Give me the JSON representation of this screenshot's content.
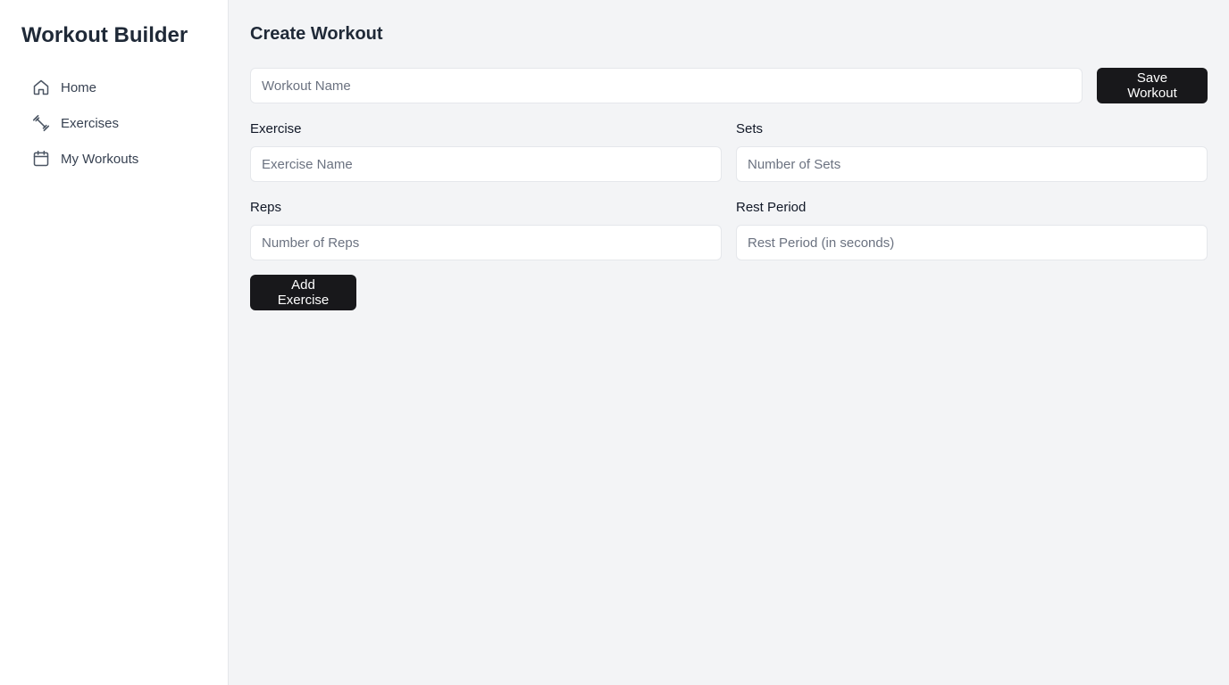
{
  "app": {
    "title": "Workout Builder"
  },
  "sidebar": {
    "items": [
      {
        "label": "Home",
        "icon": "home-icon"
      },
      {
        "label": "Exercises",
        "icon": "dumbbell-icon"
      },
      {
        "label": "My Workouts",
        "icon": "calendar-icon"
      }
    ]
  },
  "main": {
    "title": "Create Workout",
    "workout_name": {
      "placeholder": "Workout Name",
      "value": ""
    },
    "save_button": "Save Workout",
    "exercise": {
      "label": "Exercise",
      "placeholder": "Exercise Name",
      "value": ""
    },
    "sets": {
      "label": "Sets",
      "placeholder": "Number of Sets",
      "value": ""
    },
    "reps": {
      "label": "Reps",
      "placeholder": "Number of Reps",
      "value": ""
    },
    "rest": {
      "label": "Rest Period",
      "placeholder": "Rest Period (in seconds)",
      "value": ""
    },
    "add_button": "Add Exercise"
  },
  "colors": {
    "background": "#f3f4f6",
    "sidebar_bg": "#ffffff",
    "button_bg": "#18181b",
    "text_primary": "#1f2937"
  }
}
